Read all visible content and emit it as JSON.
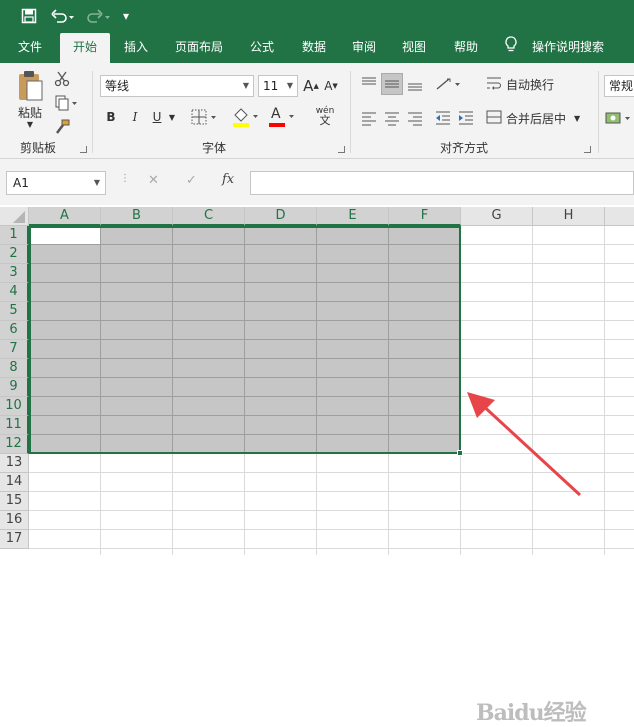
{
  "qat": {
    "more_label": "▾"
  },
  "tabs": [
    "文件",
    "开始",
    "插入",
    "页面布局",
    "公式",
    "数据",
    "审阅",
    "视图",
    "帮助"
  ],
  "tell_me": "操作说明搜索",
  "ribbon": {
    "clipboard": {
      "paste_label": "粘贴",
      "group_label": "剪贴板"
    },
    "font": {
      "font_name": "等线",
      "font_size": "11",
      "bold": "B",
      "italic": "I",
      "underline": "U",
      "font_color_glyph": "A",
      "phonetic_top": "wén",
      "phonetic_bottom": "文",
      "grow_glyph": "A",
      "shrink_glyph": "A",
      "group_label": "字体"
    },
    "alignment": {
      "wrap_text": "自动换行",
      "merge_center": "合并后居中",
      "group_label": "对齐方式"
    },
    "number": {
      "format": "常规"
    }
  },
  "formula_bar": {
    "name_box": "A1",
    "fx": "fx",
    "cancel": "✕",
    "enter": "✓",
    "content": ""
  },
  "columns": [
    "A",
    "B",
    "C",
    "D",
    "E",
    "F",
    "G",
    "H"
  ],
  "rows": [
    "1",
    "2",
    "3",
    "4",
    "5",
    "6",
    "7",
    "8",
    "9",
    "10",
    "11",
    "12",
    "13",
    "14",
    "15",
    "16",
    "17"
  ],
  "selection": {
    "range": "A1:F12"
  },
  "watermark": "Baidu经验",
  "colors": {
    "accent": "#217346",
    "selection_fill": "#c6c6c6",
    "arrow": "#e8454a"
  }
}
